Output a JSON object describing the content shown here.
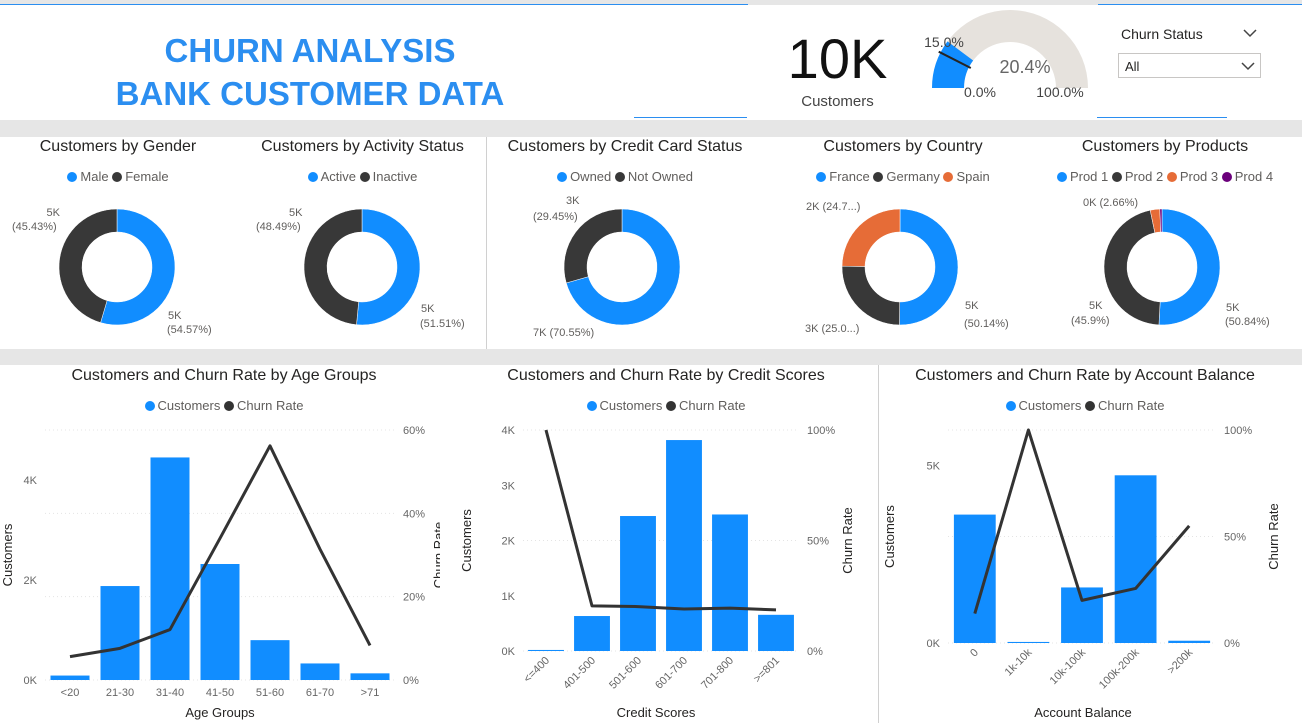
{
  "header": {
    "title_line1": "CHURN ANALYSIS",
    "title_line2": "BANK CUSTOMER DATA",
    "kpi_value": "10K",
    "kpi_label": "Customers",
    "gauge": {
      "value_label": "20.4%",
      "target_label": "15.0%",
      "min_label": "0.0%",
      "max_label": "100.0%",
      "value": 20.4,
      "target": 15.0,
      "min": 0,
      "max": 100,
      "fill_color": "#118dff",
      "track_color": "#e6e2dd"
    },
    "slicer": {
      "title": "Churn Status",
      "selected": "All"
    }
  },
  "colors": {
    "blue": "#118dff",
    "dark": "#383838",
    "orange": "#e66c37",
    "purple": "#6b007b",
    "line": "#333333"
  },
  "donuts": [
    {
      "title": "Customers by Gender",
      "legend": [
        "Male",
        "Female"
      ],
      "slices": [
        {
          "name": "Male",
          "value": 54.57,
          "color": "#118dff",
          "label1": "5K",
          "label2": "(54.57%)"
        },
        {
          "name": "Female",
          "value": 45.43,
          "color": "#383838",
          "label1": "5K",
          "label2": "(45.43%)"
        }
      ]
    },
    {
      "title": "Customers by Activity Status",
      "legend": [
        "Active",
        "Inactive"
      ],
      "slices": [
        {
          "name": "Active",
          "value": 51.51,
          "color": "#118dff",
          "label1": "5K",
          "label2": "(51.51%)"
        },
        {
          "name": "Inactive",
          "value": 48.49,
          "color": "#383838",
          "label1": "5K",
          "label2": "(48.49%)"
        }
      ]
    },
    {
      "title": "Customers by Credit Card Status",
      "legend": [
        "Owned",
        "Not Owned"
      ],
      "slices": [
        {
          "name": "Owned",
          "value": 70.55,
          "color": "#118dff",
          "label1": "7K (70.55%)",
          "label2": ""
        },
        {
          "name": "Not Owned",
          "value": 29.45,
          "color": "#383838",
          "label1": "3K",
          "label2": "(29.45%)"
        }
      ]
    },
    {
      "title": "Customers by Country",
      "legend": [
        "France",
        "Germany",
        "Spain"
      ],
      "slices": [
        {
          "name": "France",
          "value": 50.14,
          "color": "#118dff",
          "label1": "5K",
          "label2": "(50.14%)"
        },
        {
          "name": "Germany",
          "value": 25.09,
          "color": "#383838",
          "label1": "3K (25.0...)",
          "label2": ""
        },
        {
          "name": "Spain",
          "value": 24.77,
          "color": "#e66c37",
          "label1": "2K (24.7...)",
          "label2": ""
        }
      ]
    },
    {
      "title": "Customers by Products",
      "legend": [
        "Prod 1",
        "Prod 2",
        "Prod 3",
        "Prod 4"
      ],
      "slices": [
        {
          "name": "Prod 1",
          "value": 50.84,
          "color": "#118dff",
          "label1": "5K",
          "label2": "(50.84%)"
        },
        {
          "name": "Prod 2",
          "value": 45.9,
          "color": "#383838",
          "label1": "5K",
          "label2": "(45.9%)"
        },
        {
          "name": "Prod 3",
          "value": 2.66,
          "color": "#e66c37",
          "label1": "0K (2.66%)",
          "label2": ""
        },
        {
          "name": "Prod 4",
          "value": 0.6,
          "color": "#6b007b",
          "label1": "",
          "label2": ""
        }
      ]
    }
  ],
  "combo_legend": [
    "Customers",
    "Churn Rate"
  ],
  "chart_data": [
    {
      "type": "bar",
      "title": "Customers and Churn Rate by Age Groups",
      "xlabel": "Age Groups",
      "ylabel": "Customers",
      "y2label": "Churn Rate",
      "categories": [
        "<20",
        "21-30",
        "31-40",
        "41-50",
        "51-60",
        "61-70",
        ">71"
      ],
      "series": [
        {
          "name": "Customers",
          "type": "bar",
          "values": [
            89,
            1879,
            4451,
            2320,
            797,
            331,
            133
          ]
        },
        {
          "name": "Churn Rate",
          "type": "line",
          "axis": "right",
          "values": [
            5.6,
            7.6,
            12.1,
            34.0,
            56.2,
            31.4,
            8.3
          ]
        }
      ],
      "ylim": [
        0,
        5000
      ],
      "yticks": [
        "0K",
        "2K",
        "4K"
      ],
      "ytick_values": [
        0,
        2000,
        4000
      ],
      "y2lim": [
        0,
        60
      ],
      "y2ticks": [
        "0%",
        "20%",
        "40%",
        "60%"
      ],
      "y2tick_values": [
        0,
        20,
        40,
        60
      ]
    },
    {
      "type": "bar",
      "title": "Customers and Churn Rate by Credit Scores",
      "xlabel": "Credit Scores",
      "ylabel": "Customers",
      "y2label": "Churn Rate",
      "categories": [
        "<=400",
        "401-500",
        "501-600",
        "601-700",
        "701-800",
        ">=801"
      ],
      "series": [
        {
          "name": "Customers",
          "type": "bar",
          "values": [
            19,
            633,
            2443,
            3818,
            2471,
            655
          ]
        },
        {
          "name": "Churn Rate",
          "type": "line",
          "axis": "right",
          "values": [
            100,
            20.4,
            20.1,
            19.0,
            19.4,
            18.6
          ]
        }
      ],
      "ylim": [
        0,
        4000
      ],
      "yticks": [
        "0K",
        "1K",
        "2K",
        "3K",
        "4K"
      ],
      "ytick_values": [
        0,
        1000,
        2000,
        3000,
        4000
      ],
      "y2lim": [
        0,
        100
      ],
      "y2ticks": [
        "0%",
        "50%",
        "100%"
      ],
      "y2tick_values": [
        0,
        50,
        100
      ]
    },
    {
      "type": "bar",
      "title": "Customers and Churn Rate by Account Balance",
      "xlabel": "Account Balance",
      "ylabel": "Customers",
      "y2label": "Churn Rate",
      "categories": [
        "0",
        "1k-10k",
        "10k-100k",
        "100k-200k",
        ">200k"
      ],
      "series": [
        {
          "name": "Customers",
          "type": "bar",
          "values": [
            3617,
            30,
            1565,
            4724,
            64
          ]
        },
        {
          "name": "Churn Rate",
          "type": "line",
          "axis": "right",
          "values": [
            13.8,
            100,
            20.0,
            25.6,
            55.0
          ]
        }
      ],
      "ylim": [
        0,
        6000
      ],
      "yticks": [
        "0K",
        "5K"
      ],
      "ytick_values": [
        0,
        5000
      ],
      "y2lim": [
        0,
        100
      ],
      "y2ticks": [
        "0%",
        "50%",
        "100%"
      ],
      "y2tick_values": [
        0,
        50,
        100
      ]
    }
  ]
}
